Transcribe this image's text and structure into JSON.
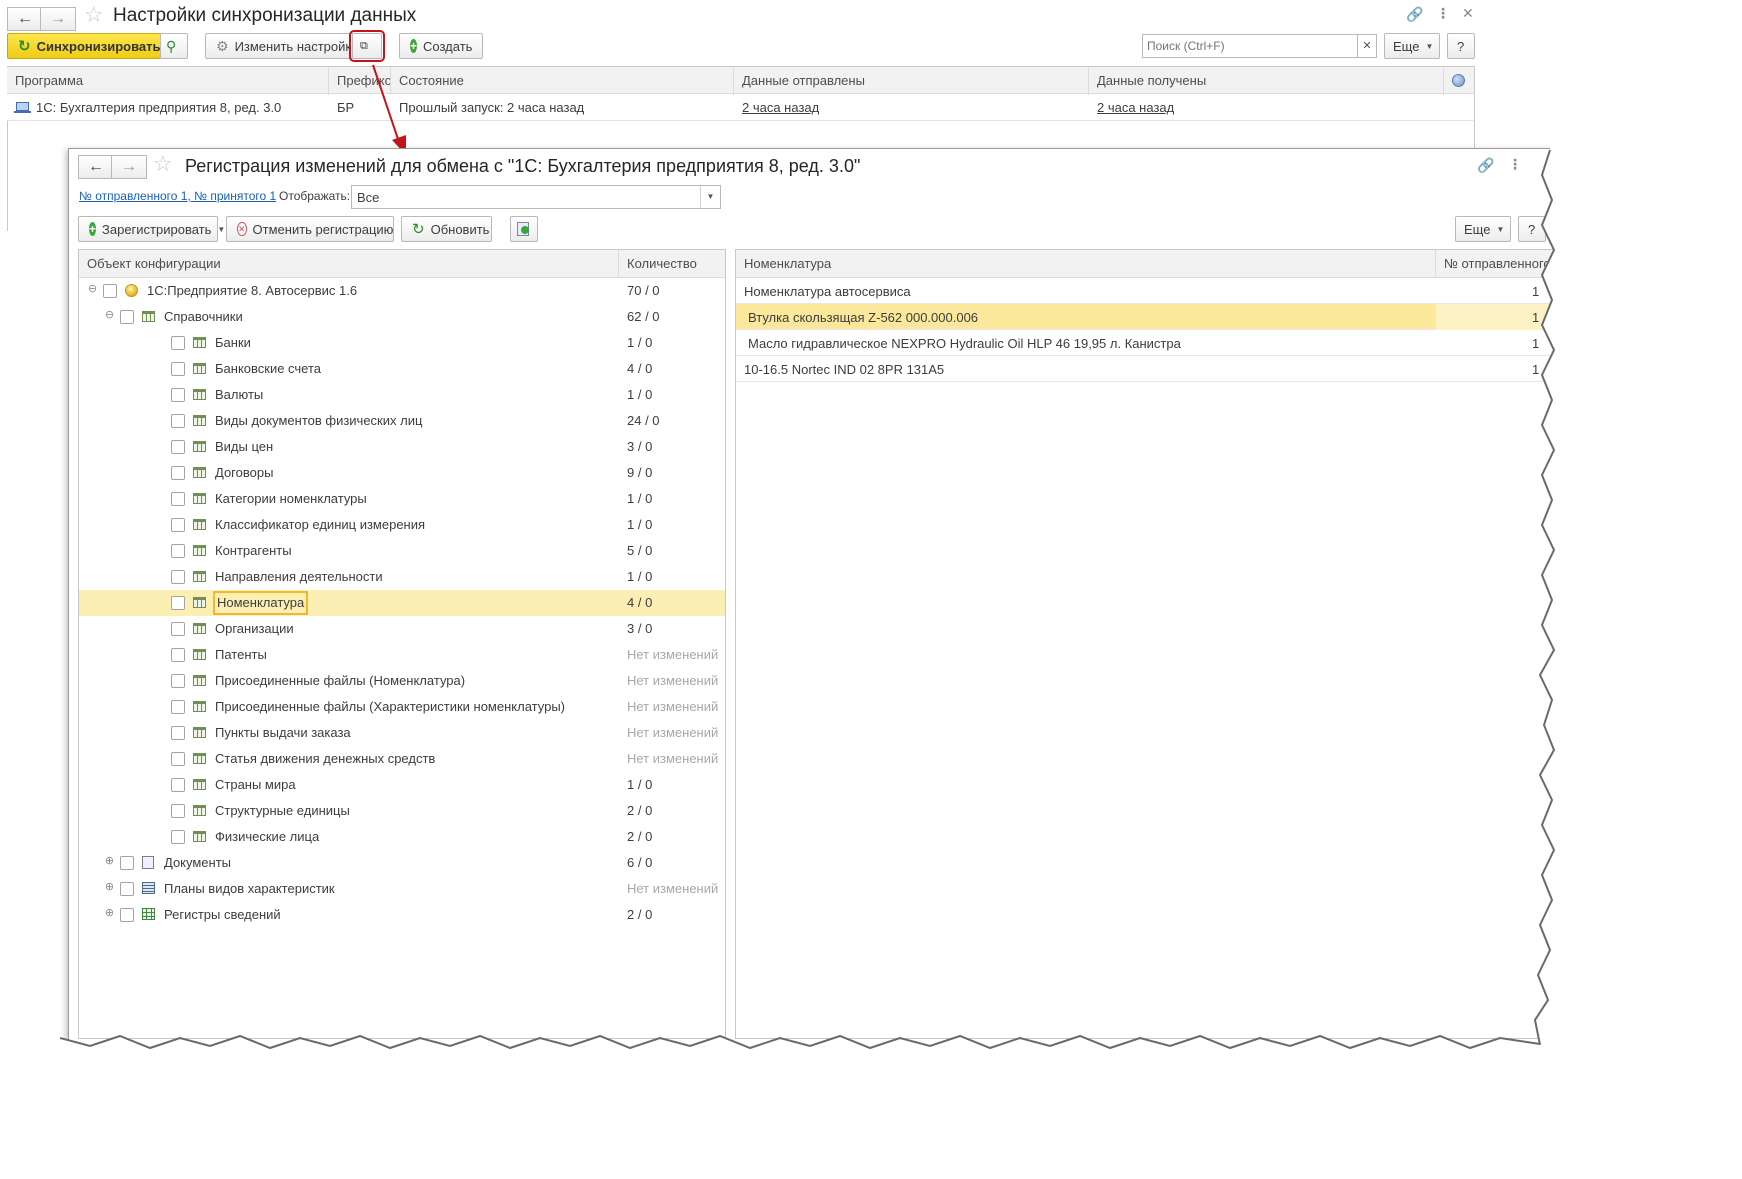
{
  "main_window": {
    "title": "Настройки синхронизации данных",
    "toolbar": {
      "sync_label": "Синхронизировать",
      "change_settings_label": "Изменить настройки",
      "create_label": "Создать",
      "search_placeholder": "Поиск (Ctrl+F)",
      "more_label": "Еще",
      "help_label": "?"
    },
    "table": {
      "columns": [
        "Программа",
        "Префикс",
        "Состояние",
        "Данные отправлены",
        "Данные получены"
      ],
      "rows": [
        {
          "program": "1С: Бухгалтерия предприятия 8, ред. 3.0",
          "prefix": "БР",
          "state": "Прошлый запуск: 2 часа назад",
          "sent": "2 часа назад",
          "received": "2 часа назад"
        }
      ]
    }
  },
  "inner_window": {
    "title": "Регистрация изменений для обмена с  \"1С: Бухгалтерия предприятия 8, ред. 3.0\"",
    "numbers_link": "№ отправленного 1, № принятого 1",
    "display_label": "Отображать:",
    "display_value": "Все",
    "toolbar": {
      "register_label": "Зарегистрировать",
      "unregister_label": "Отменить регистрацию",
      "refresh_label": "Обновить",
      "more_label": "Еще",
      "help_label": "?"
    },
    "tree": {
      "col_object": "Объект конфигурации",
      "col_count": "Количество",
      "rows": [
        {
          "label": "1С:Предприятие 8. Автосервис 1.6",
          "count": "70 / 0"
        },
        {
          "label": "Справочники",
          "count": "62 / 0"
        },
        {
          "label": "Банки",
          "count": "1 / 0"
        },
        {
          "label": "Банковские счета",
          "count": "4 / 0"
        },
        {
          "label": "Валюты",
          "count": "1 / 0"
        },
        {
          "label": "Виды документов физических лиц",
          "count": "24 / 0"
        },
        {
          "label": "Виды цен",
          "count": "3 / 0"
        },
        {
          "label": "Договоры",
          "count": "9 / 0"
        },
        {
          "label": "Категории номенклатуры",
          "count": "1 / 0"
        },
        {
          "label": "Классификатор единиц измерения",
          "count": "1 / 0"
        },
        {
          "label": "Контрагенты",
          "count": "5 / 0"
        },
        {
          "label": "Направления деятельности",
          "count": "1 / 0"
        },
        {
          "label": "Номенклатура",
          "count": "4 / 0"
        },
        {
          "label": "Организации",
          "count": "3 / 0"
        },
        {
          "label": "Патенты",
          "count": "Нет изменений"
        },
        {
          "label": "Присоединенные файлы (Номенклатура)",
          "count": "Нет изменений"
        },
        {
          "label": "Присоединенные файлы (Характеристики номенклатуры)",
          "count": "Нет изменений"
        },
        {
          "label": "Пункты выдачи заказа",
          "count": "Нет изменений"
        },
        {
          "label": "Статья движения денежных средств",
          "count": "Нет изменений"
        },
        {
          "label": "Страны мира",
          "count": "1 / 0"
        },
        {
          "label": "Структурные единицы",
          "count": "2 / 0"
        },
        {
          "label": "Физические лица",
          "count": "2 / 0"
        },
        {
          "label": "Документы",
          "count": "6 / 0"
        },
        {
          "label": "Планы видов характеристик",
          "count": "Нет изменений"
        },
        {
          "label": "Регистры сведений",
          "count": "2 / 0"
        }
      ]
    },
    "right_table": {
      "col_name": "Номенклатура",
      "col_sent": "№ отправленного",
      "rows": [
        {
          "name": "Номенклатура автосервиса",
          "sent": "1"
        },
        {
          "name": "Втулка скользящая Z-562 000.000.006",
          "sent": "1"
        },
        {
          "name": "Масло гидравлическое NEXPRO Hydraulic Oil HLP 46 19,95 л. Канистра",
          "sent": "1"
        },
        {
          "name": "10-16.5 Nortec IND 02 8PR 131A5",
          "sent": "1"
        }
      ]
    }
  },
  "colors": {
    "sync_button": "#f5d722",
    "selection": "#fcefb4",
    "arrow": "#c4141a"
  }
}
